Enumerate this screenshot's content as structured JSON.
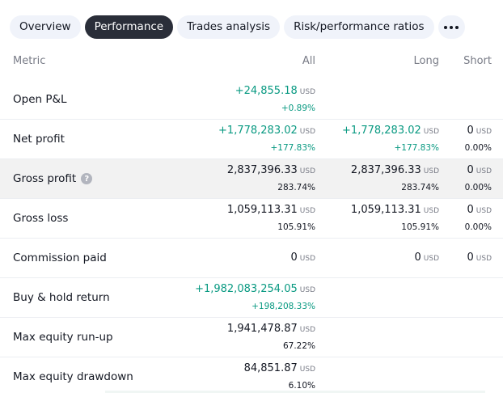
{
  "tabs": [
    {
      "label": "Overview",
      "active": false
    },
    {
      "label": "Performance",
      "active": true
    },
    {
      "label": "Trades analysis",
      "active": false
    },
    {
      "label": "Risk/performance ratios",
      "active": false
    }
  ],
  "more_icon": "more-horizontal-icon",
  "headers": {
    "metric": "Metric",
    "all": "All",
    "long": "Long",
    "short": "Short"
  },
  "unit": "USD",
  "colors": {
    "positive": "#089981",
    "text": "#131722",
    "muted": "#787b86",
    "active_tab": "#2a2e39",
    "tab_bg": "#f0f3fa",
    "highlight_row": "#f2f2f2"
  },
  "rows": [
    {
      "metric": "Open P&L",
      "all": {
        "value": "+24,855.18",
        "pct": "+0.89%",
        "positive": true
      }
    },
    {
      "metric": "Net profit",
      "all": {
        "value": "+1,778,283.02",
        "pct": "+177.83%",
        "positive": true
      },
      "long": {
        "value": "+1,778,283.02",
        "pct": "+177.83%",
        "positive": true
      },
      "short": {
        "value": "0",
        "pct": "0.00%"
      }
    },
    {
      "metric": "Gross profit",
      "info_icon": "question-icon",
      "info_glyph": "?",
      "all": {
        "value": "2,837,396.33",
        "pct": "283.74%"
      },
      "long": {
        "value": "2,837,396.33",
        "pct": "283.74%"
      },
      "short": {
        "value": "0",
        "pct": "0.00%"
      }
    },
    {
      "metric": "Gross loss",
      "all": {
        "value": "1,059,113.31",
        "pct": "105.91%"
      },
      "long": {
        "value": "1,059,113.31",
        "pct": "105.91%"
      },
      "short": {
        "value": "0",
        "pct": "0.00%"
      }
    },
    {
      "metric": "Commission paid",
      "all": {
        "value": "0"
      },
      "long": {
        "value": "0"
      },
      "short": {
        "value": "0"
      }
    },
    {
      "metric": "Buy & hold return",
      "all": {
        "value": "+1,982,083,254.05",
        "pct": "+198,208.33%",
        "positive": true
      }
    },
    {
      "metric": "Max equity run-up",
      "all": {
        "value": "1,941,478.87",
        "pct": "67.22%"
      }
    },
    {
      "metric": "Max equity drawdown",
      "all": {
        "value": "84,851.87",
        "pct": "6.10%"
      }
    }
  ]
}
